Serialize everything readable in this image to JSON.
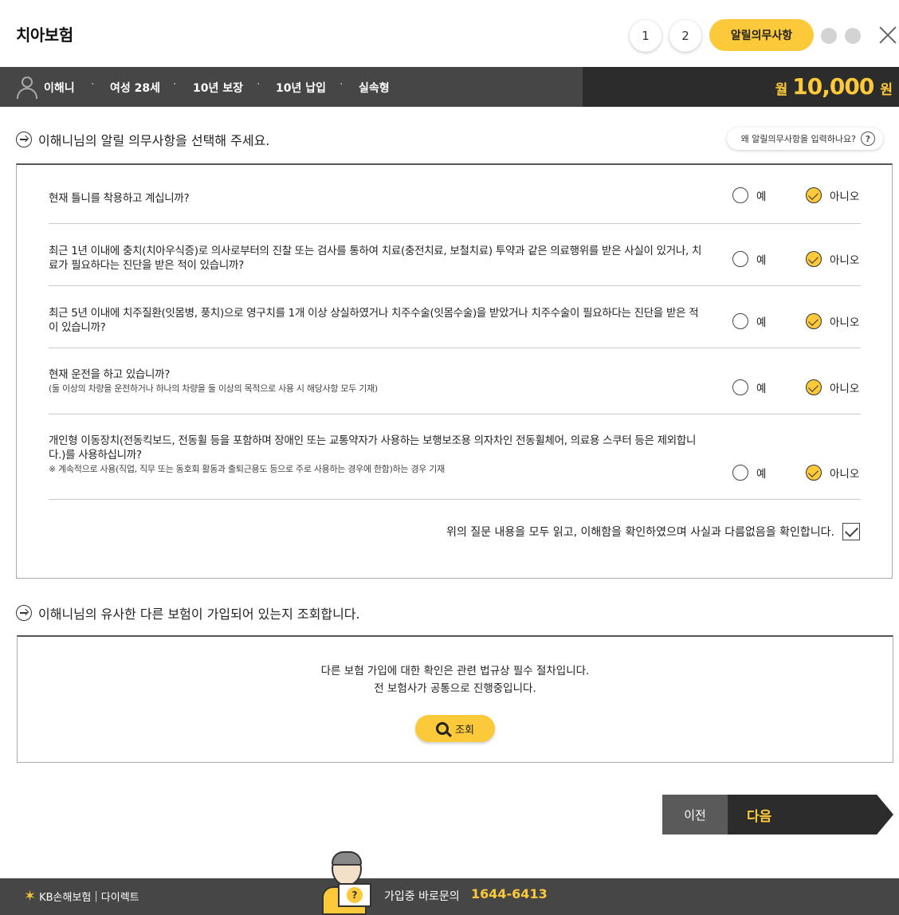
{
  "header": {
    "title": "치아보험",
    "steps": [
      "1",
      "2"
    ],
    "active_step": "알릴의무사항"
  },
  "summary": {
    "name": "이해니",
    "items": [
      "여성 28세",
      "10년 보장",
      "10년 납입",
      "실속형"
    ],
    "separator": "·",
    "price_prefix": "월",
    "price_amount": "10,000",
    "price_unit": "원"
  },
  "section1": {
    "title": "이해니님의 알릴 의무사항을 선택해 주세요.",
    "help_label": "왜 알릴의무사항을 입력하나요?",
    "help_icon": "?"
  },
  "questions": [
    {
      "text": "현재 틀니를 착용하고 계십니까?",
      "note": "",
      "yes": "예",
      "no": "아니오",
      "selected": "no"
    },
    {
      "text": "최근 1년 이내에 충치(치아우식증)로 의사로부터의 진찰 또는 검사를 통하여 치료(충전치료, 보철치료) 투약과 같은 의료행위를 받은 사실이 있거나, 치료가 필요하다는 진단을 받은 적이 있습니까?",
      "note": "",
      "yes": "예",
      "no": "아니오",
      "selected": "no"
    },
    {
      "text": "최근 5년 이내에 치주질환(잇몸병, 풍치)으로 영구치를 1개 이상 상실하였거나 치주수술(잇몸수술)을 받았거나 치주수술이 필요하다는 진단을 받은 적이 있습니까?",
      "note": "",
      "yes": "예",
      "no": "아니오",
      "selected": "no"
    },
    {
      "text": "현재 운전을 하고 있습니까?",
      "note": "(둘 이상의 차량을 운전하거나 하나의 차량을 둘 이상의 목적으로 사용 시 해당사항 모두 기재)",
      "yes": "예",
      "no": "아니오",
      "selected": "no"
    },
    {
      "text": "개인형 이동장치(전동킥보드, 전동휠 등을 포함하며 장애인 또는 교통약자가 사용하는 보행보조용 의자차인 전동휠체어, 의료용 스쿠터 등은 제외합니다.)를 사용하십니까?",
      "note": "※ 계속적으로 사용(직업, 직무 또는 동호회 활동과 출퇴근용도 등으로 주로 사용하는 경우에 한함)하는 경우 기재",
      "yes": "예",
      "no": "아니오",
      "selected": "no"
    }
  ],
  "confirm_text": "위의 질문 내용을 모두 읽고, 이해함을 확인하였으며 사실과 다름없음을 확인합니다.",
  "section2": {
    "title": "이해니님의 유사한 다른 보험이 가입되어 있는지 조회합니다.",
    "line1": "다른 보험 가입에 대한 확인은 관련 법규상 필수 절차입니다.",
    "line2": "전 보험사가 공통으로 진행중입니다.",
    "lookup_label": "조회"
  },
  "nav": {
    "prev": "이전",
    "next": "다음"
  },
  "footer": {
    "brand": "KB손해보험",
    "brand_sub": "다이렉트",
    "brand_sep": "|",
    "call_label": "가입중 바로문의",
    "call_number": "1644-6413",
    "char_sign": "?"
  },
  "colors": {
    "accent": "#fcc93a",
    "dark_bar": "#464646",
    "darker": "#2c2c2c"
  }
}
